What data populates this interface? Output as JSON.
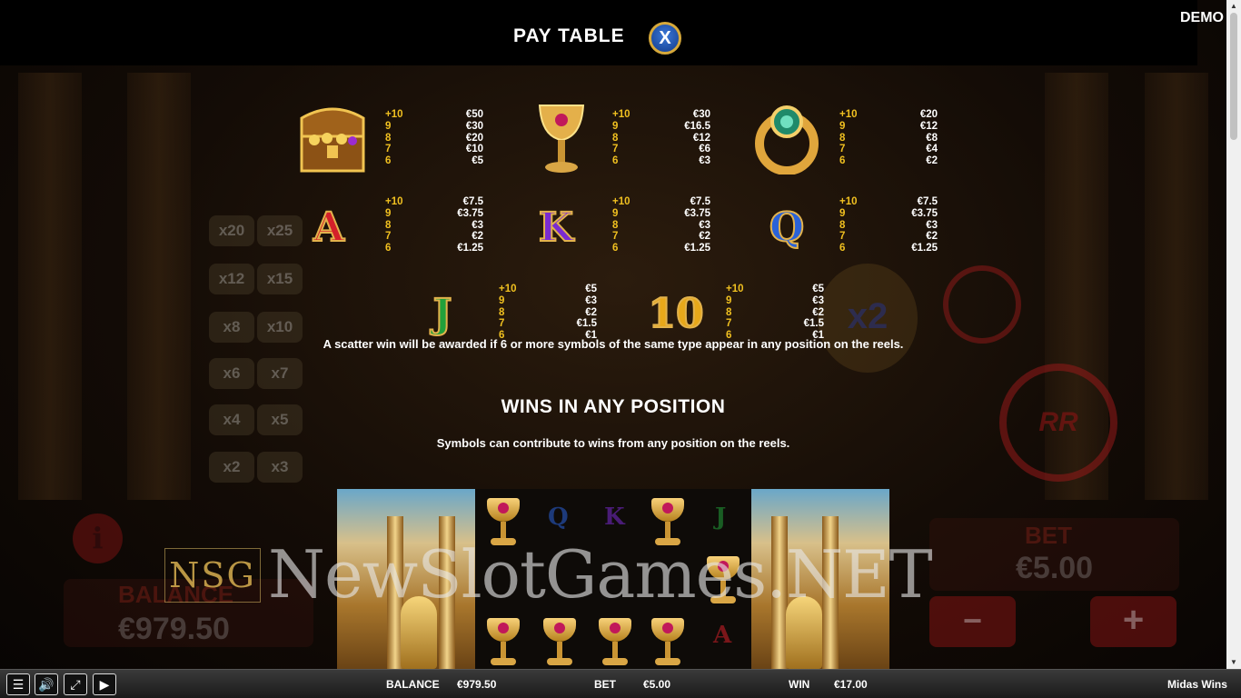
{
  "header": {
    "title": "PAY TABLE",
    "close_label": "X",
    "mode_badge": "DEMO"
  },
  "symbols": [
    {
      "name": "treasure-chest",
      "pays": [
        {
          "count": "+10",
          "value": "€50"
        },
        {
          "count": "9",
          "value": "€30"
        },
        {
          "count": "8",
          "value": "€20"
        },
        {
          "count": "7",
          "value": "€10"
        },
        {
          "count": "6",
          "value": "€5"
        }
      ]
    },
    {
      "name": "golden-chalice",
      "pays": [
        {
          "count": "+10",
          "value": "€30"
        },
        {
          "count": "9",
          "value": "€16.5"
        },
        {
          "count": "8",
          "value": "€12"
        },
        {
          "count": "7",
          "value": "€6"
        },
        {
          "count": "6",
          "value": "€3"
        }
      ]
    },
    {
      "name": "emerald-ring",
      "pays": [
        {
          "count": "+10",
          "value": "€20"
        },
        {
          "count": "9",
          "value": "€12"
        },
        {
          "count": "8",
          "value": "€8"
        },
        {
          "count": "7",
          "value": "€4"
        },
        {
          "count": "6",
          "value": "€2"
        }
      ]
    },
    {
      "name": "letter-a",
      "glyph": "A",
      "color": "#d4202a",
      "pays": [
        {
          "count": "+10",
          "value": "€7.5"
        },
        {
          "count": "9",
          "value": "€3.75"
        },
        {
          "count": "8",
          "value": "€3"
        },
        {
          "count": "7",
          "value": "€2"
        },
        {
          "count": "6",
          "value": "€1.25"
        }
      ]
    },
    {
      "name": "letter-k",
      "glyph": "K",
      "color": "#7a2bd0",
      "pays": [
        {
          "count": "+10",
          "value": "€7.5"
        },
        {
          "count": "9",
          "value": "€3.75"
        },
        {
          "count": "8",
          "value": "€3"
        },
        {
          "count": "7",
          "value": "€2"
        },
        {
          "count": "6",
          "value": "€1.25"
        }
      ]
    },
    {
      "name": "letter-q",
      "glyph": "Q",
      "color": "#2a62d8",
      "pays": [
        {
          "count": "+10",
          "value": "€7.5"
        },
        {
          "count": "9",
          "value": "€3.75"
        },
        {
          "count": "8",
          "value": "€3"
        },
        {
          "count": "7",
          "value": "€2"
        },
        {
          "count": "6",
          "value": "€1.25"
        }
      ]
    },
    {
      "name": "letter-j",
      "glyph": "J",
      "color": "#22a03a",
      "pays": [
        {
          "count": "+10",
          "value": "€5"
        },
        {
          "count": "9",
          "value": "€3"
        },
        {
          "count": "8",
          "value": "€2"
        },
        {
          "count": "7",
          "value": "€1.5"
        },
        {
          "count": "6",
          "value": "€1"
        }
      ]
    },
    {
      "name": "number-10",
      "glyph": "10",
      "color": "#e8a81a",
      "pays": [
        {
          "count": "+10",
          "value": "€5"
        },
        {
          "count": "9",
          "value": "€3"
        },
        {
          "count": "8",
          "value": "€2"
        },
        {
          "count": "7",
          "value": "€1.5"
        },
        {
          "count": "6",
          "value": "€1"
        }
      ]
    }
  ],
  "scatter_text": "A scatter win will be awarded if 6 or more symbols of the same type appear in any position on the reels.",
  "wins_section": {
    "title": "WINS IN ANY POSITION",
    "description": "Symbols can contribute to wins from any position on the reels."
  },
  "background": {
    "multipliers": [
      "x20",
      "x25",
      "x12",
      "x15",
      "x8",
      "x10",
      "x6",
      "x7",
      "x4",
      "x5",
      "x2",
      "x3"
    ],
    "balance_label": "BALANCE",
    "balance_value": "€979.50",
    "bet_label": "BET",
    "bet_value": "€5.00",
    "bonus_multiplier": "x2",
    "info_glyph": "i",
    "minus_glyph": "−",
    "plus_glyph": "+",
    "respin_label": "RR"
  },
  "watermark": {
    "logo": "NSG",
    "text": "NewSlotGames.NET"
  },
  "bottom_bar": {
    "balance_label": "BALANCE",
    "balance_value": "€979.50",
    "bet_label": "BET",
    "bet_value": "€5.00",
    "win_label": "WIN",
    "win_value": "€17.00",
    "game_name": "Midas Wins"
  },
  "colors": {
    "accent_gold": "#f0c020",
    "brand_red": "#d4202a",
    "close_blue": "#2a62d8"
  }
}
